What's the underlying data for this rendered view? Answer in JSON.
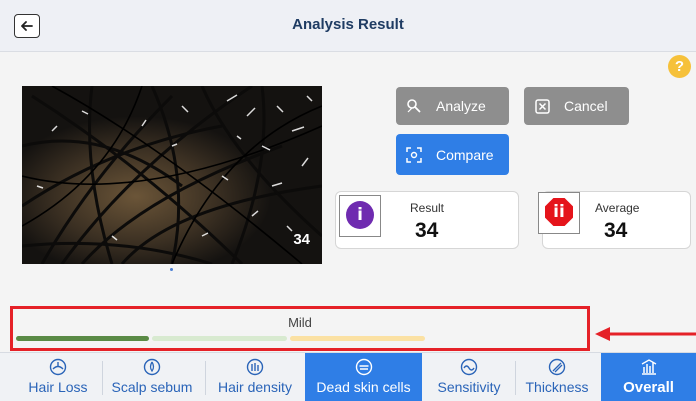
{
  "header": {
    "title": "Analysis Result",
    "back_icon": "arrow-left-icon"
  },
  "help": {
    "label": "?",
    "color": "#f6c13a"
  },
  "image": {
    "overlay_value": "34"
  },
  "actions": {
    "analyze_label": "Analyze",
    "cancel_label": "Cancel",
    "compare_label": "Compare"
  },
  "result": {
    "label": "Result",
    "value": "34",
    "badge": "i",
    "badge_color": "#6f2bb0"
  },
  "average": {
    "label": "Average",
    "value": "34",
    "badge": "ii",
    "badge_color": "#e5141b"
  },
  "severity": {
    "label": "Mild",
    "segments": [
      {
        "color": "#5a8a45"
      },
      {
        "color": "#d8ead0"
      },
      {
        "color": "#fbe1a3"
      }
    ]
  },
  "tabs": [
    {
      "label": "Hair Loss",
      "icon": "hair-loss-icon"
    },
    {
      "label": "Scalp sebum",
      "icon": "scalp-sebum-icon"
    },
    {
      "label": "Hair density",
      "icon": "hair-density-icon"
    },
    {
      "label": "Dead skin cells",
      "icon": "dead-skin-cells-icon",
      "active": true
    },
    {
      "label": "Sensitivity",
      "icon": "sensitivity-icon"
    },
    {
      "label": "Thickness",
      "icon": "thickness-icon"
    },
    {
      "label": "Overall",
      "icon": "overall-icon"
    }
  ],
  "accent_color": "#2f7ee6",
  "highlight_color": "#e52127"
}
